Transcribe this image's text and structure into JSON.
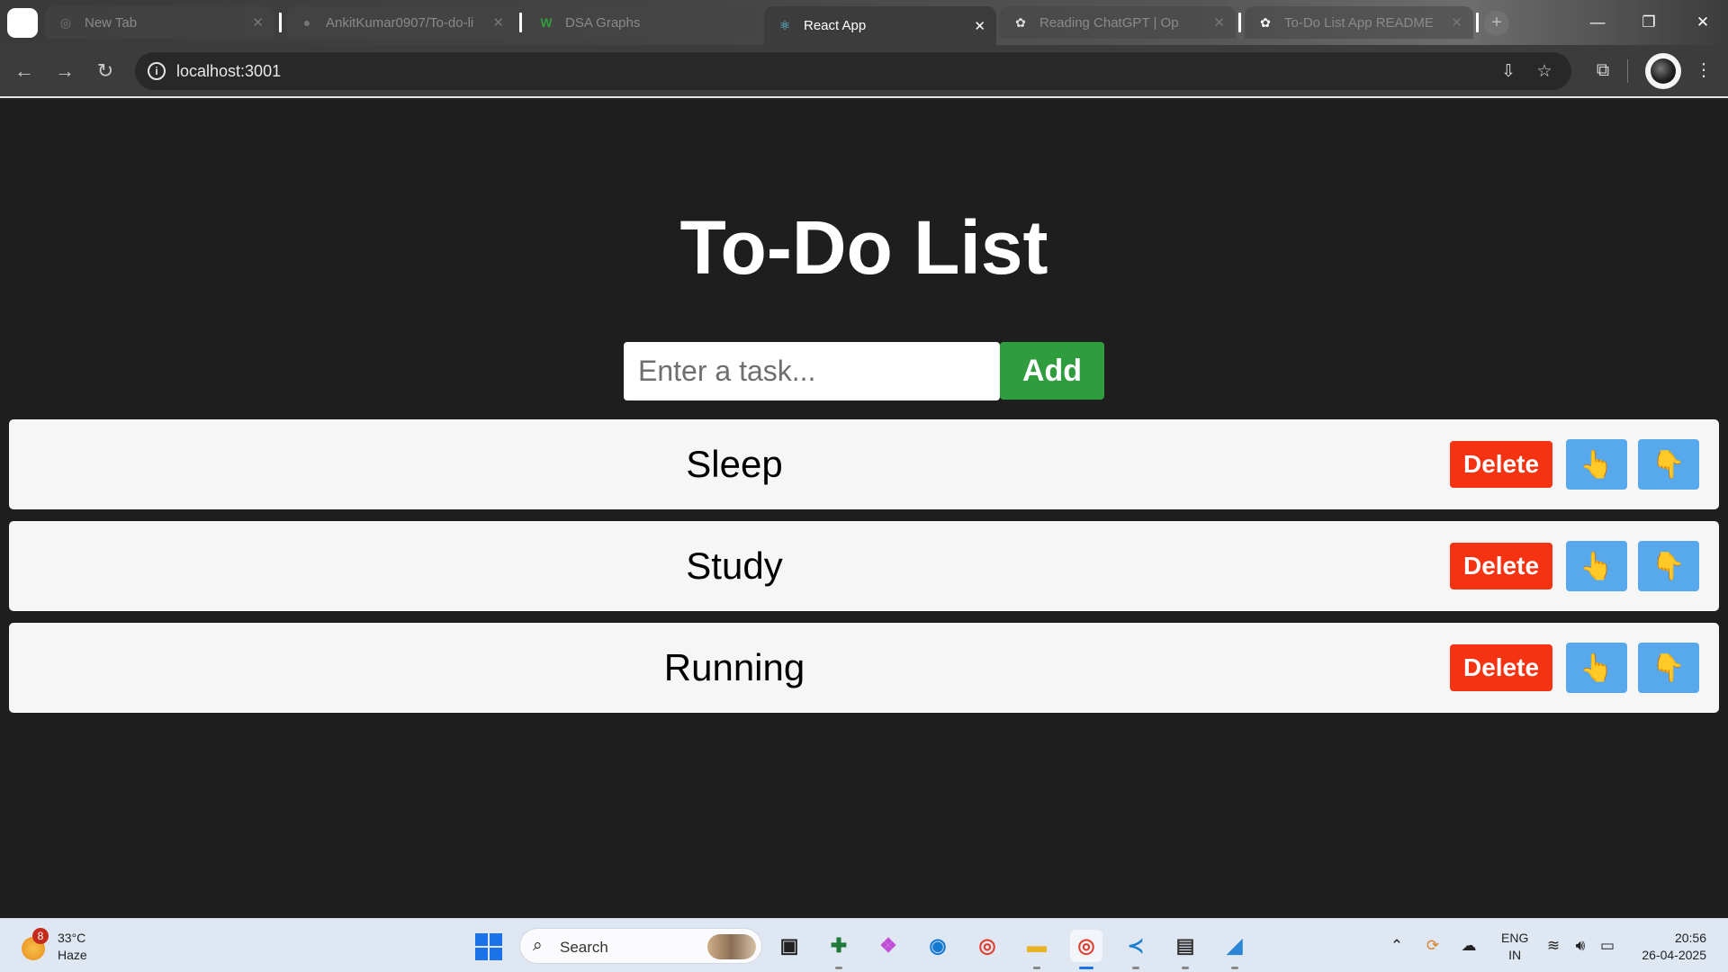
{
  "browser": {
    "tabs": [
      {
        "title": "New Tab",
        "favicon": "chrome-icon",
        "active": false
      },
      {
        "title": "AnkitKumar0907/To-do-li",
        "favicon": "github-icon",
        "active": false
      },
      {
        "title": "DSA Graphs",
        "favicon": "w-icon",
        "active": false
      },
      {
        "title": "React App",
        "favicon": "react-icon",
        "active": true
      },
      {
        "title": "Reading ChatGPT | Op",
        "favicon": "openai-icon",
        "active": false
      },
      {
        "title": "To-Do List App README",
        "favicon": "openai-icon",
        "active": false
      }
    ],
    "tab_close_glyph": "✕",
    "new_tab_glyph": "+",
    "url": "localhost:3001"
  },
  "app": {
    "title": "To-Do List",
    "input": {
      "placeholder": "Enter a task...",
      "value": ""
    },
    "add_label": "Add",
    "tasks": [
      {
        "text": "Sleep",
        "delete_label": "Delete",
        "up_icon": "👆",
        "down_icon": "👇"
      },
      {
        "text": "Study",
        "delete_label": "Delete",
        "up_icon": "👆",
        "down_icon": "👇"
      },
      {
        "text": "Running",
        "delete_label": "Delete",
        "up_icon": "👆",
        "down_icon": "👇"
      }
    ]
  },
  "taskbar": {
    "weather": {
      "badge": "8",
      "temp": "33°C",
      "condition": "Haze"
    },
    "search_label": "Search",
    "language": {
      "line1": "ENG",
      "line2": "IN"
    },
    "time": "20:56",
    "date": "26-04-2025"
  },
  "colors": {
    "page_bg": "#1e1e1e",
    "add_button": "#2f9c3e",
    "delete_button": "#f53211",
    "move_button": "#58a8ec"
  }
}
